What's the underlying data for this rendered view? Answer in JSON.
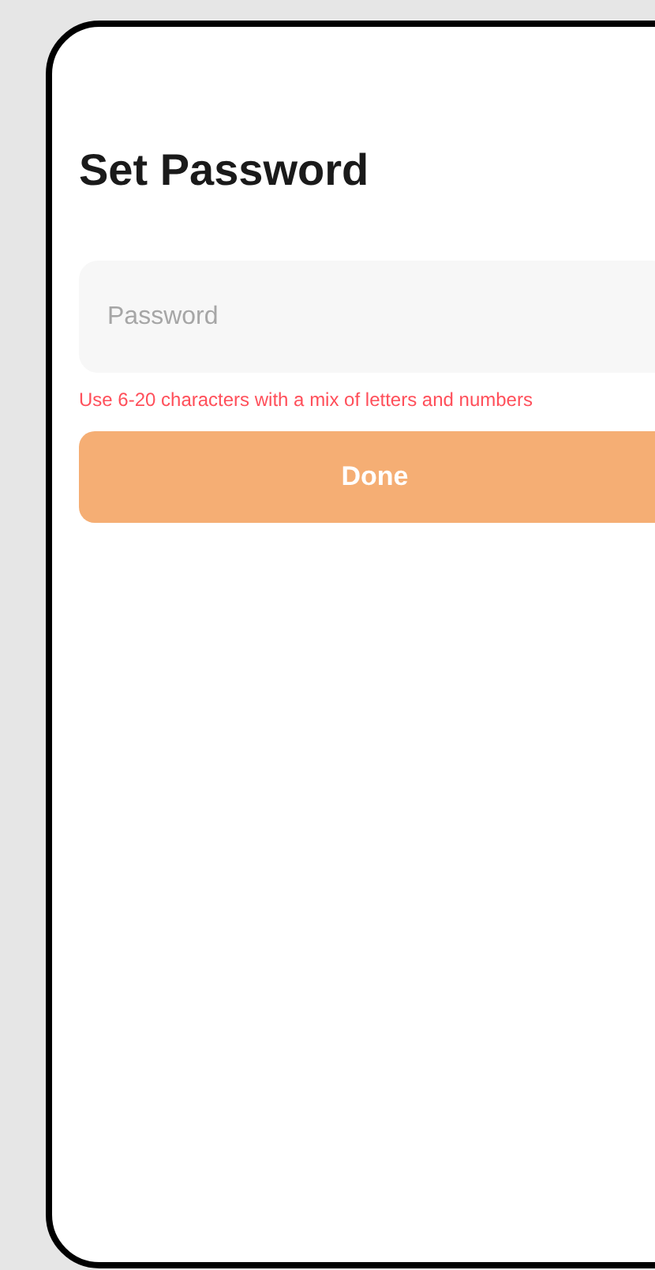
{
  "title": "Set Password",
  "password_field": {
    "placeholder": "Password"
  },
  "hint": "Use 6-20 characters with a mix of letters and numbers",
  "done_button": {
    "label": "Done",
    "disabled": true
  }
}
